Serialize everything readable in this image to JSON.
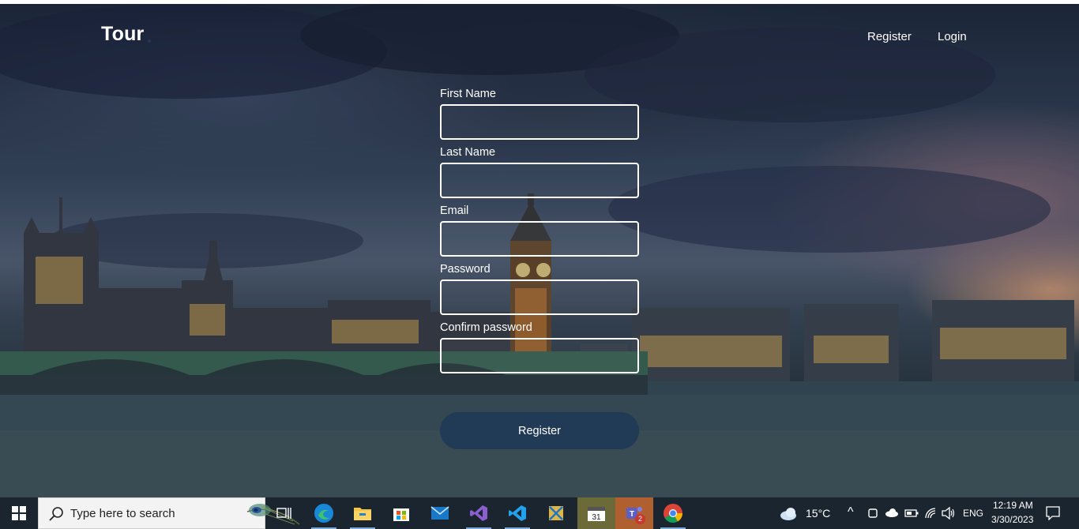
{
  "header": {
    "brand": "Tour",
    "nav": [
      {
        "label": "Register"
      },
      {
        "label": "Login"
      }
    ]
  },
  "form": {
    "fields": [
      {
        "label": "First Name",
        "value": "",
        "placeholder": ""
      },
      {
        "label": "Last Name",
        "value": "",
        "placeholder": ""
      },
      {
        "label": "Email",
        "value": "",
        "placeholder": ""
      },
      {
        "label": "Password",
        "value": "",
        "placeholder": ""
      },
      {
        "label": "Confirm password",
        "value": "",
        "placeholder": ""
      }
    ],
    "submit_label": "Register"
  },
  "taskbar": {
    "search_placeholder": "Type here to search",
    "apps": [
      "start-icon",
      "task-view-icon",
      "edge-icon",
      "file-explorer-icon",
      "store-icon",
      "mail-icon",
      "visual-studio-icon",
      "vscode-icon",
      "snipping-tool-icon",
      "calendar-app-icon",
      "teams-icon",
      "chrome-icon"
    ],
    "teams_badge": "2",
    "weather": "15°C",
    "language": "ENG",
    "time": "12:19 AM",
    "date": "3/30/2023"
  },
  "colors": {
    "button": "#213a55",
    "taskbar": "#1b2530"
  }
}
